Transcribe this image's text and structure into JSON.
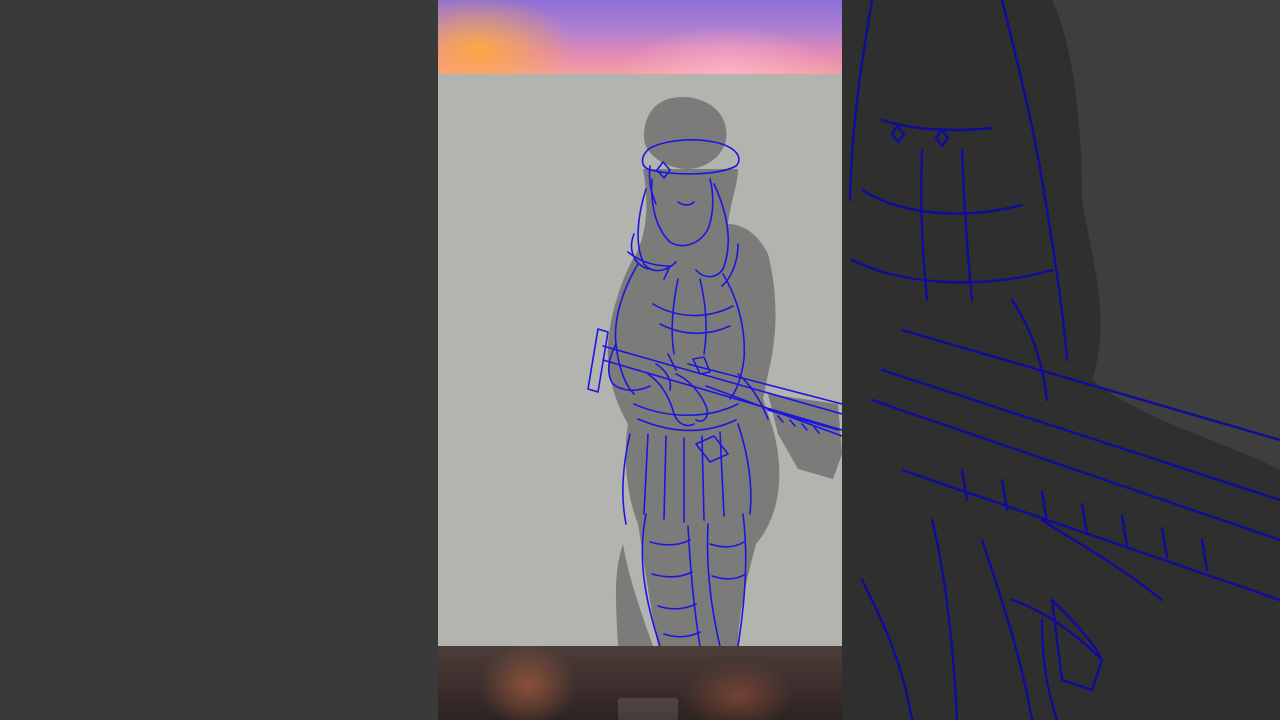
{
  "app": {
    "title": "",
    "view": "vertical-short-video-player"
  },
  "colors": {
    "pillar_left": "#3a3a3a",
    "pillar_right": "#3e3e3e",
    "canvas": "#b3b3b0",
    "silhouette": "#7a7a78",
    "sketch_line": "#1a14d6",
    "sketch_line_dark": "#14108a"
  },
  "content": {
    "canvas_subject": "line-art-character-with-rifle"
  }
}
